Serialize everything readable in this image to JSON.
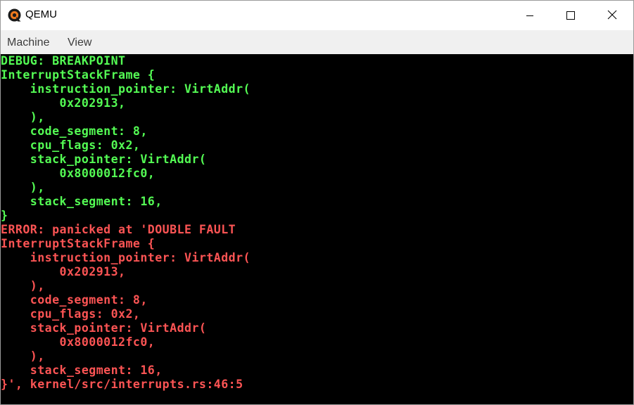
{
  "window": {
    "title": "QEMU",
    "icon": "qemu-logo-icon"
  },
  "controls": {
    "minimize_icon": "minimize-icon",
    "maximize_icon": "maximize-icon",
    "close_icon": "close-icon"
  },
  "menu": {
    "items": [
      {
        "label": "Machine"
      },
      {
        "label": "View"
      }
    ]
  },
  "colors": {
    "debug_text": "#54fc54",
    "error_text": "#fc5454",
    "screen_bg": "#000000"
  },
  "console": {
    "lines": [
      {
        "text": "DEBUG: BREAKPOINT",
        "color": "green"
      },
      {
        "text": "InterruptStackFrame {",
        "color": "green"
      },
      {
        "text": "    instruction_pointer: VirtAddr(",
        "color": "green"
      },
      {
        "text": "        0x202913,",
        "color": "green"
      },
      {
        "text": "    ),",
        "color": "green"
      },
      {
        "text": "    code_segment: 8,",
        "color": "green"
      },
      {
        "text": "    cpu_flags: 0x2,",
        "color": "green"
      },
      {
        "text": "    stack_pointer: VirtAddr(",
        "color": "green"
      },
      {
        "text": "        0x8000012fc0,",
        "color": "green"
      },
      {
        "text": "    ),",
        "color": "green"
      },
      {
        "text": "    stack_segment: 16,",
        "color": "green"
      },
      {
        "text": "}",
        "color": "green"
      },
      {
        "text": "ERROR: panicked at 'DOUBLE FAULT",
        "color": "red"
      },
      {
        "text": "InterruptStackFrame {",
        "color": "red"
      },
      {
        "text": "    instruction_pointer: VirtAddr(",
        "color": "red"
      },
      {
        "text": "        0x202913,",
        "color": "red"
      },
      {
        "text": "    ),",
        "color": "red"
      },
      {
        "text": "    code_segment: 8,",
        "color": "red"
      },
      {
        "text": "    cpu_flags: 0x2,",
        "color": "red"
      },
      {
        "text": "    stack_pointer: VirtAddr(",
        "color": "red"
      },
      {
        "text": "        0x8000012fc0,",
        "color": "red"
      },
      {
        "text": "    ),",
        "color": "red"
      },
      {
        "text": "    stack_segment: 16,",
        "color": "red"
      },
      {
        "text": "}', kernel/src/interrupts.rs:46:5",
        "color": "red"
      }
    ]
  }
}
